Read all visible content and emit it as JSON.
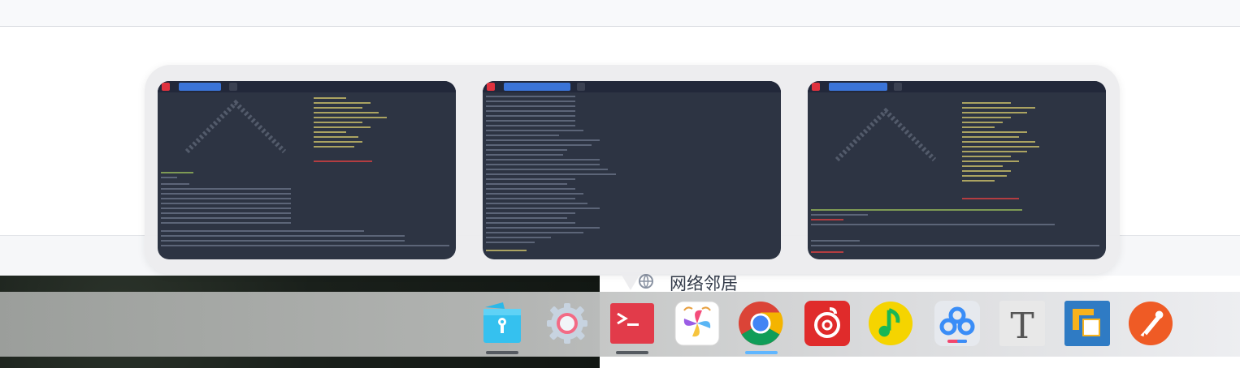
{
  "background_window": {
    "sidebar_item_label": "网络邻居"
  },
  "window_previews": [
    {
      "app": "terminal",
      "tab_label": ""
    },
    {
      "app": "terminal",
      "tab_label": ""
    },
    {
      "app": "terminal",
      "tab_label": ""
    }
  ],
  "dock": {
    "items": [
      {
        "name": "file-manager",
        "icon": "folder-icon",
        "running": true,
        "indicator": "dark"
      },
      {
        "name": "settings",
        "icon": "gear-icon",
        "running": false
      },
      {
        "name": "terminal",
        "icon": "terminal-icon",
        "running": true,
        "indicator": "dark"
      },
      {
        "name": "image-viewer",
        "icon": "pinwheel-icon",
        "running": false
      },
      {
        "name": "chrome",
        "icon": "chrome-icon",
        "running": true,
        "indicator": "blue"
      },
      {
        "name": "netease-music",
        "icon": "netease-music-icon",
        "running": false
      },
      {
        "name": "qq-music",
        "icon": "qq-music-icon",
        "running": false
      },
      {
        "name": "baidu-netdisk",
        "icon": "baidu-netdisk-icon",
        "running": false
      },
      {
        "name": "typora",
        "icon": "typora-icon",
        "running": false,
        "glyph": "T"
      },
      {
        "name": "virtualbox",
        "icon": "virtualbox-icon",
        "running": false
      },
      {
        "name": "postman",
        "icon": "postman-icon",
        "running": false
      }
    ]
  },
  "colors": {
    "terminal_bg": "#2d3443",
    "terminal_red": "#e23b4a",
    "chrome_indicator": "#5fb6ff",
    "postman_orange": "#ef5b25"
  }
}
